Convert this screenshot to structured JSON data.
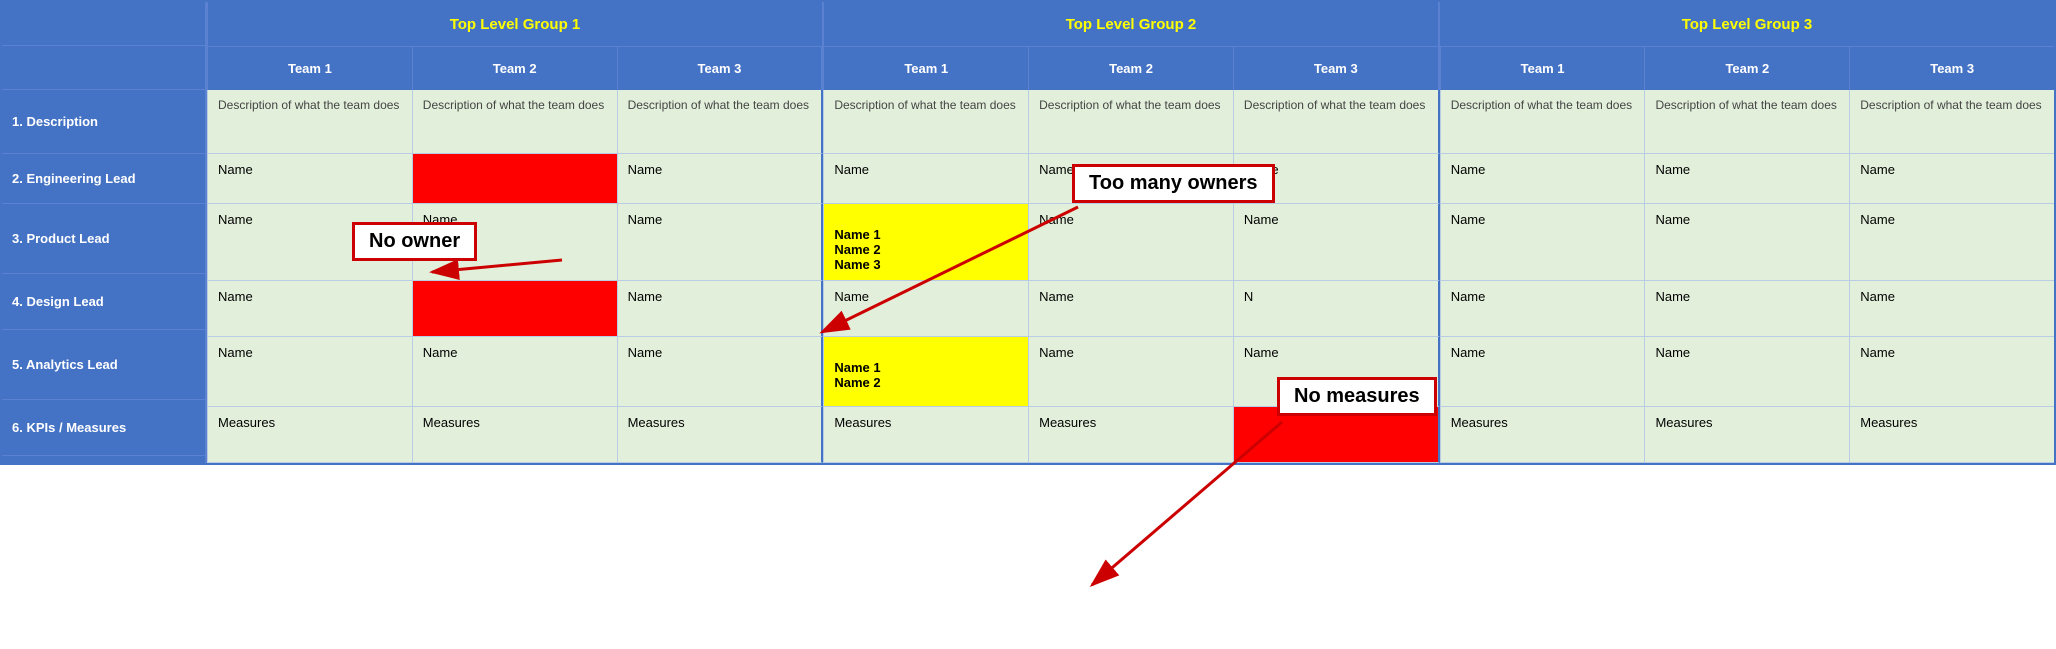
{
  "groups": [
    {
      "label": "Top Level Group 1",
      "color": "#ffff00",
      "teams": [
        "Team 1",
        "Team 2",
        "Team 3"
      ]
    },
    {
      "label": "Top Level Group 2",
      "color": "#ffff00",
      "teams": [
        "Team 1",
        "Team 2",
        "Team 3"
      ]
    },
    {
      "label": "Top Level Group 3",
      "color": "#ffff00",
      "teams": [
        "Team 1",
        "Team 2",
        "Team 3"
      ]
    }
  ],
  "rows": [
    {
      "label": "1. Description",
      "key": "description",
      "cells": [
        "Description of what the team does",
        "Description of what the team does",
        "Description of what the team does",
        "Description of what the team does",
        "Description of what the team does",
        "Description of what the team does",
        "Description of what the team does",
        "Description of what the team does",
        "Description of what the team does"
      ]
    },
    {
      "label": "2. Engineering Lead",
      "key": "engineering",
      "cells": [
        "Name",
        "",
        "Name",
        "Name",
        "Name",
        "Name",
        "Name",
        "Name",
        "Name"
      ],
      "special": {
        "1": "no-owner"
      }
    },
    {
      "label": "3. Product Lead",
      "key": "product",
      "cells": [
        "Name",
        "Name",
        "Name",
        "Name 1\nName 2\nName 3",
        "Name",
        "Name",
        "Name",
        "Name",
        "Name"
      ],
      "special": {
        "3": "multi-owner"
      }
    },
    {
      "label": "4. Design Lead",
      "key": "design",
      "cells": [
        "Name",
        "",
        "Name",
        "Name",
        "Name",
        "N",
        "Name",
        "Name",
        "Name"
      ],
      "special": {
        "1": "no-owner-red"
      }
    },
    {
      "label": "5. Analytics Lead",
      "key": "analytics",
      "cells": [
        "Name",
        "Name",
        "Name",
        "Name 1\nName 2",
        "Name",
        "Name",
        "Name",
        "Name",
        "Name"
      ],
      "special": {
        "3": "multi-owner"
      }
    },
    {
      "label": "6. KPIs / Measures",
      "key": "kpis",
      "cells": [
        "Measures",
        "Measures",
        "Measures",
        "Measures",
        "Measures",
        "",
        "Measures",
        "Measures",
        "Measures"
      ],
      "special": {
        "5": "no-measures-red"
      }
    }
  ],
  "annotations": {
    "no_owner": "No owner",
    "too_many_owners": "Too many owners",
    "no_measures": "No measures"
  }
}
